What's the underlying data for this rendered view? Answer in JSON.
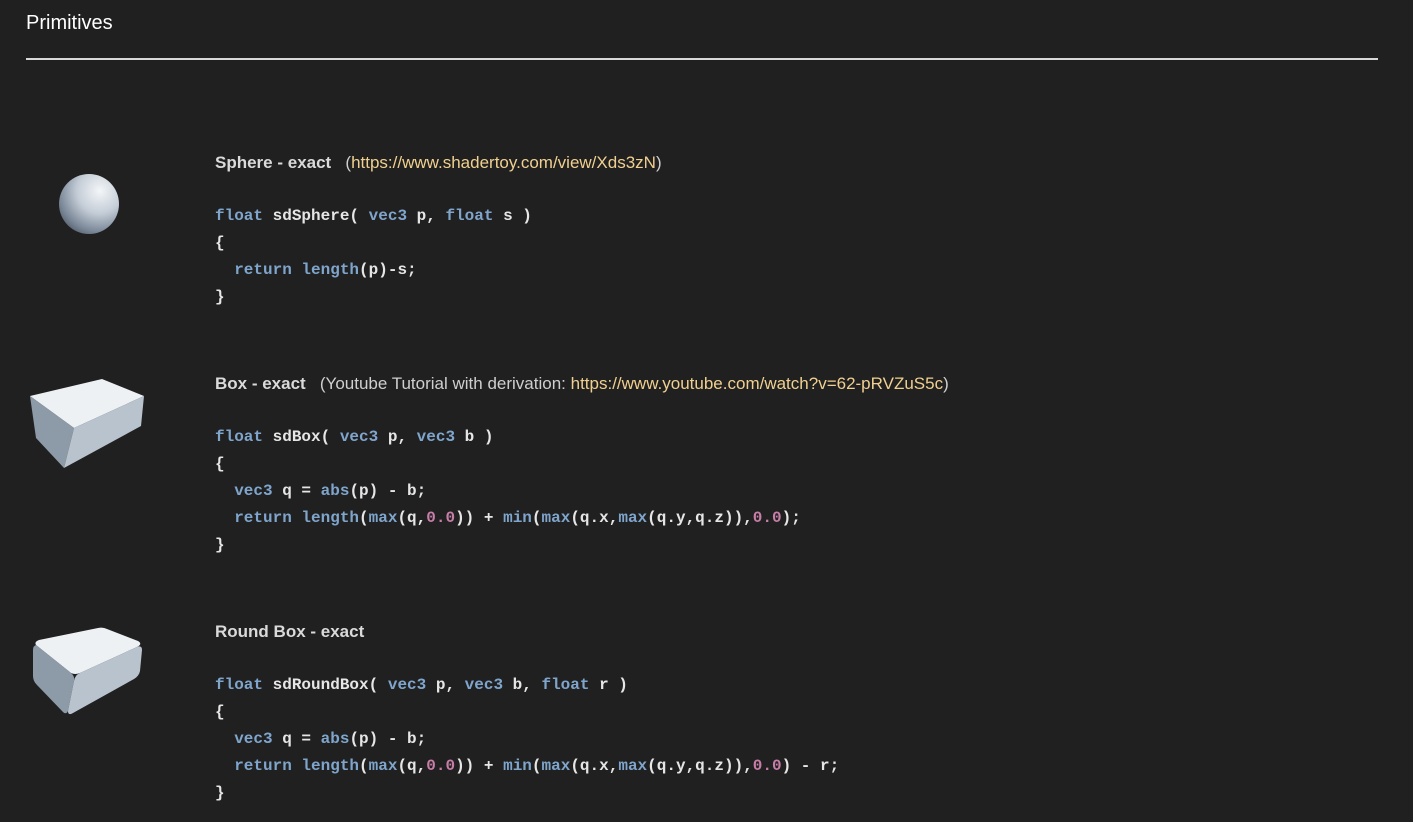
{
  "section": {
    "title": "Primitives"
  },
  "entries": [
    {
      "name": "Sphere - exact",
      "note_prefix": "(",
      "link": "https://www.shadertoy.com/view/Xds3zN",
      "note_suffix": ")",
      "thumbnail_icon": "sphere-icon",
      "code": [
        [
          [
            "kw",
            "float"
          ],
          [
            "t",
            " sdSphere( "
          ],
          [
            "kw",
            "vec3"
          ],
          [
            "t",
            " p, "
          ],
          [
            "kw",
            "float"
          ],
          [
            "t",
            " s )"
          ]
        ],
        [
          [
            "t",
            "{"
          ]
        ],
        [
          [
            "t",
            "  "
          ],
          [
            "kw",
            "return"
          ],
          [
            "t",
            " "
          ],
          [
            "kw",
            "length"
          ],
          [
            "t",
            "(p)-s;"
          ]
        ],
        [
          [
            "t",
            "}"
          ]
        ]
      ]
    },
    {
      "name": "Box - exact",
      "note_prefix": "(Youtube Tutorial with derivation: ",
      "link": "https://www.youtube.com/watch?v=62-pRVZuS5c",
      "note_suffix": ")",
      "thumbnail_icon": "box-icon",
      "code": [
        [
          [
            "kw",
            "float"
          ],
          [
            "t",
            " sdBox( "
          ],
          [
            "kw",
            "vec3"
          ],
          [
            "t",
            " p, "
          ],
          [
            "kw",
            "vec3"
          ],
          [
            "t",
            " b )"
          ]
        ],
        [
          [
            "t",
            "{"
          ]
        ],
        [
          [
            "t",
            "  "
          ],
          [
            "kw",
            "vec3"
          ],
          [
            "t",
            " q = "
          ],
          [
            "kw",
            "abs"
          ],
          [
            "t",
            "(p) - b;"
          ]
        ],
        [
          [
            "t",
            "  "
          ],
          [
            "kw",
            "return"
          ],
          [
            "t",
            " "
          ],
          [
            "kw",
            "length"
          ],
          [
            "t",
            "("
          ],
          [
            "kw",
            "max"
          ],
          [
            "t",
            "(q,"
          ],
          [
            "num",
            "0.0"
          ],
          [
            "t",
            ")) + "
          ],
          [
            "kw",
            "min"
          ],
          [
            "t",
            "("
          ],
          [
            "kw",
            "max"
          ],
          [
            "t",
            "(q.x,"
          ],
          [
            "kw",
            "max"
          ],
          [
            "t",
            "(q.y,q.z)),"
          ],
          [
            "num",
            "0.0"
          ],
          [
            "t",
            ");"
          ]
        ],
        [
          [
            "t",
            "}"
          ]
        ]
      ]
    },
    {
      "name": "Round Box - exact",
      "note_prefix": "",
      "link": "",
      "note_suffix": "",
      "thumbnail_icon": "round-box-icon",
      "code": [
        [
          [
            "kw",
            "float"
          ],
          [
            "t",
            " sdRoundBox( "
          ],
          [
            "kw",
            "vec3"
          ],
          [
            "t",
            " p, "
          ],
          [
            "kw",
            "vec3"
          ],
          [
            "t",
            " b, "
          ],
          [
            "kw",
            "float"
          ],
          [
            "t",
            " r )"
          ]
        ],
        [
          [
            "t",
            "{"
          ]
        ],
        [
          [
            "t",
            "  "
          ],
          [
            "kw",
            "vec3"
          ],
          [
            "t",
            " q = "
          ],
          [
            "kw",
            "abs"
          ],
          [
            "t",
            "(p) - b;"
          ]
        ],
        [
          [
            "t",
            "  "
          ],
          [
            "kw",
            "return"
          ],
          [
            "t",
            " "
          ],
          [
            "kw",
            "length"
          ],
          [
            "t",
            "("
          ],
          [
            "kw",
            "max"
          ],
          [
            "t",
            "(q,"
          ],
          [
            "num",
            "0.0"
          ],
          [
            "t",
            ")) + "
          ],
          [
            "kw",
            "min"
          ],
          [
            "t",
            "("
          ],
          [
            "kw",
            "max"
          ],
          [
            "t",
            "(q.x,"
          ],
          [
            "kw",
            "max"
          ],
          [
            "t",
            "(q.y,q.z)),"
          ],
          [
            "num",
            "0.0"
          ],
          [
            "t",
            ") - r;"
          ]
        ],
        [
          [
            "t",
            "}"
          ]
        ]
      ]
    }
  ],
  "colors": {
    "background": "#202020",
    "link": "#f0d090",
    "keyword": "#7fa5cc",
    "number": "#c87ea8"
  }
}
